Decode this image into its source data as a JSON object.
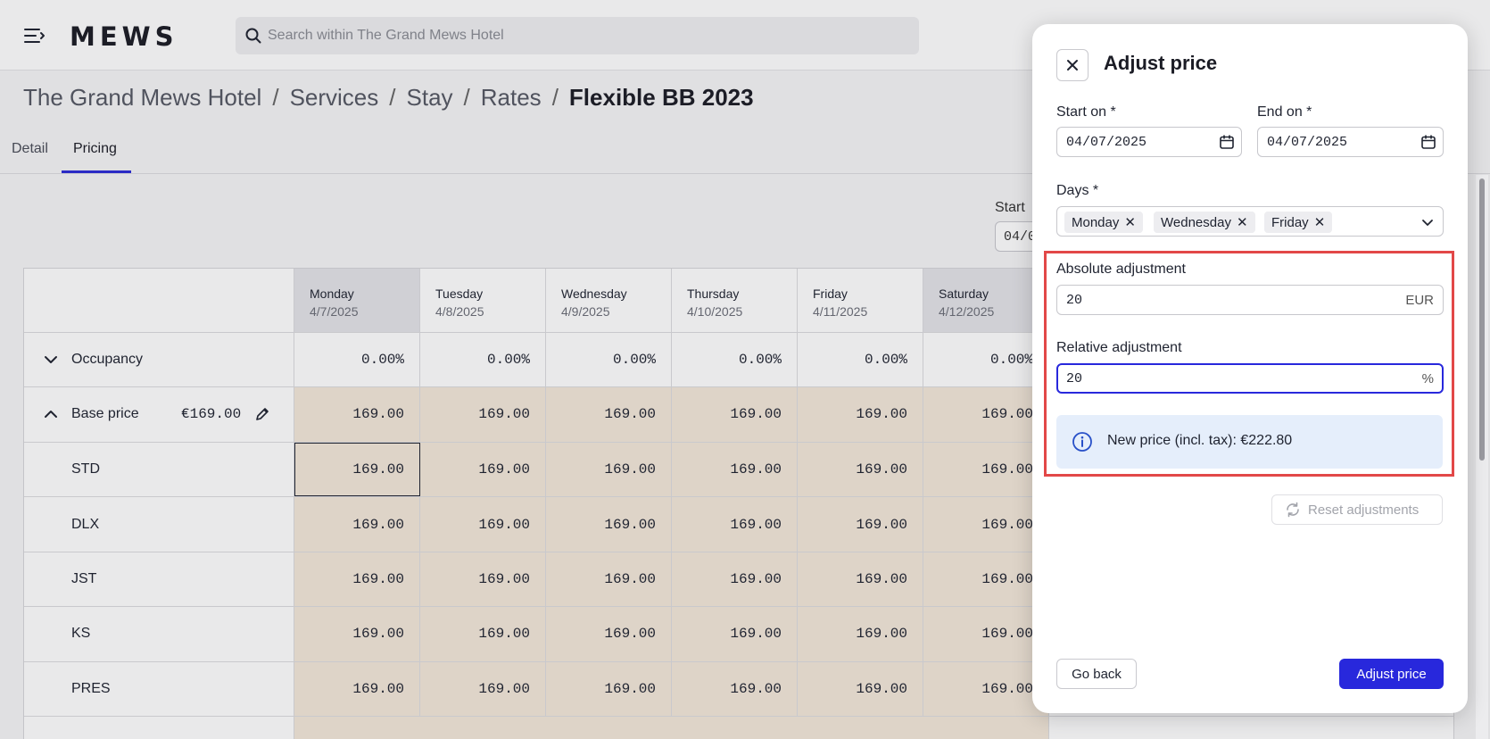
{
  "app": {
    "logo": "MEWS",
    "search_placeholder": "Search within The Grand Mews Hotel"
  },
  "breadcrumb": {
    "items": [
      "The Grand Mews Hotel",
      "Services",
      "Stay",
      "Rates"
    ],
    "current": "Flexible BB 2023",
    "separator": "/"
  },
  "tabs": [
    {
      "label": "Detail"
    },
    {
      "label": "Pricing"
    }
  ],
  "background_filter": {
    "start_label": "Start",
    "start_value": "04/0"
  },
  "grid": {
    "days": [
      {
        "day": "Monday",
        "date": "4/7/2025"
      },
      {
        "day": "Tuesday",
        "date": "4/8/2025"
      },
      {
        "day": "Wednesday",
        "date": "4/9/2025"
      },
      {
        "day": "Thursday",
        "date": "4/10/2025"
      },
      {
        "day": "Friday",
        "date": "4/11/2025"
      },
      {
        "day": "Saturday",
        "date": "4/12/2025"
      }
    ],
    "occupancy": {
      "label": "Occupancy",
      "values": [
        "0.00%",
        "0.00%",
        "0.00%",
        "0.00%",
        "0.00%",
        "0.00%"
      ]
    },
    "base_price": {
      "label": "Base price",
      "amount": "€169.00",
      "values": [
        "169.00",
        "169.00",
        "169.00",
        "169.00",
        "169.00",
        "169.00"
      ]
    },
    "room_rows": [
      {
        "label": "STD",
        "values": [
          "169.00",
          "169.00",
          "169.00",
          "169.00",
          "169.00",
          "169.00"
        ]
      },
      {
        "label": "DLX",
        "values": [
          "169.00",
          "169.00",
          "169.00",
          "169.00",
          "169.00",
          "169.00"
        ]
      },
      {
        "label": "JST",
        "values": [
          "169.00",
          "169.00",
          "169.00",
          "169.00",
          "169.00",
          "169.00"
        ]
      },
      {
        "label": "KS",
        "values": [
          "169.00",
          "169.00",
          "169.00",
          "169.00",
          "169.00",
          "169.00"
        ]
      },
      {
        "label": "PRES",
        "values": [
          "169.00",
          "169.00",
          "169.00",
          "169.00",
          "169.00",
          "169.00"
        ]
      }
    ]
  },
  "panel": {
    "title": "Adjust price",
    "start_label": "Start on *",
    "start_value": "04/07/2025",
    "end_label": "End on *",
    "end_value": "04/07/2025",
    "days_label": "Days *",
    "days_selected": [
      "Monday",
      "Wednesday",
      "Friday"
    ],
    "absolute_label": "Absolute adjustment",
    "absolute_value": "20",
    "absolute_suffix": "EUR",
    "relative_label": "Relative adjustment",
    "relative_value": "20",
    "relative_suffix": "%",
    "info_text": "New price (incl. tax): €222.80",
    "reset_label": "Reset adjustments",
    "back_label": "Go back",
    "submit_label": "Adjust price"
  },
  "colors": {
    "accent": "#2828dc",
    "highlight_border": "#e24848",
    "price_cell_bg": "#f3e8da",
    "info_bg": "#e5eefb"
  }
}
